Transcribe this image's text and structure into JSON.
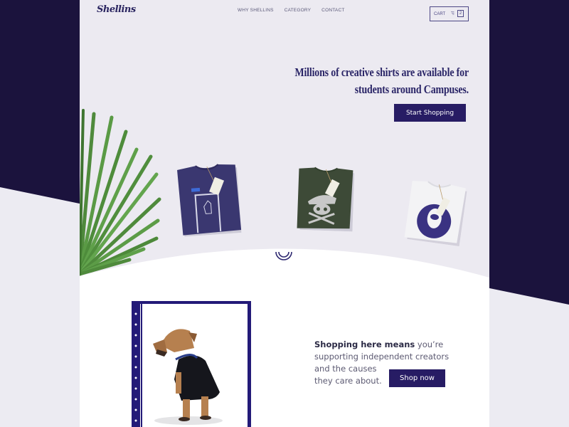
{
  "colors": {
    "brand_dark": "#1b133d",
    "accent": "#271c64",
    "page_bg": "#eceaf1",
    "text_primary": "#2a2567"
  },
  "header": {
    "logo": "Shellins",
    "nav": [
      {
        "label": "WHY SHELLINS"
      },
      {
        "label": "CATEGORY"
      },
      {
        "label": "CONTACT"
      }
    ],
    "cart": {
      "label": "CART",
      "count": "2",
      "icon": "cart-icon"
    }
  },
  "hero": {
    "title_line1": "Millions of creative shirts are available for",
    "title_line2": "students around Campuses.",
    "cta_label": "Start Shopping",
    "products": [
      {
        "name": "navy-hand-graphic-shirt",
        "color": "#3a3770"
      },
      {
        "name": "green-skull-beret-shirt",
        "color": "#3d4a37"
      },
      {
        "name": "white-astronaut-graphic-shirt",
        "color": "#f3f3f5"
      }
    ],
    "scroll_icon": "scroll-down-icon"
  },
  "promo": {
    "bold_text": "Shopping here means",
    "text_line1_rest": " you’re",
    "text_line2": "supporting independent creators",
    "text_line3": "and the causes",
    "text_line4": "they care about.",
    "cta_label": "Shop now",
    "image": "dog-wearing-shirt-photo"
  }
}
